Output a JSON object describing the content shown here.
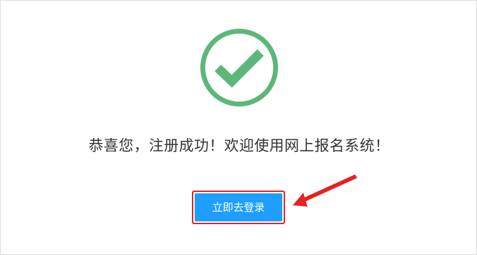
{
  "result": {
    "icon": "check-circle-icon",
    "icon_color": "#5cb87a",
    "message": "恭喜您，注册成功！欢迎使用网上报名系统！"
  },
  "actions": {
    "login_label": "立即去登录",
    "button_color": "#1e9fff"
  },
  "annotation": {
    "highlight_color": "#e52222",
    "arrow": "red-arrow-pointer-icon"
  }
}
